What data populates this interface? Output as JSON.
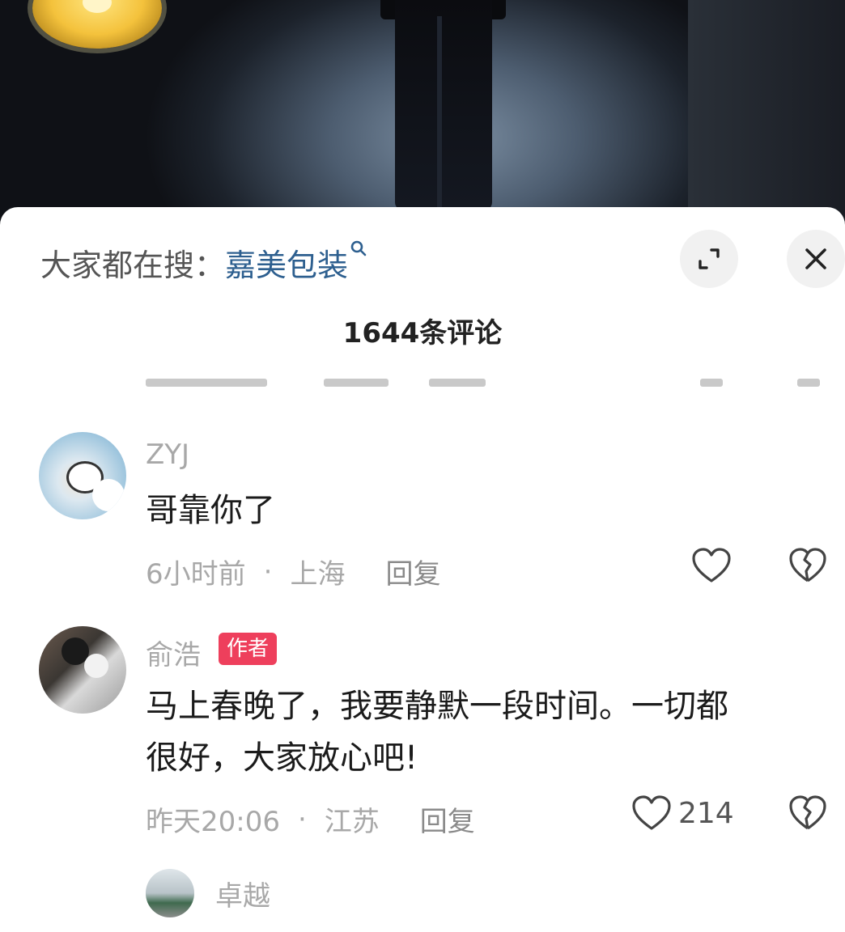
{
  "search_bar": {
    "prefix": "大家都在搜：",
    "term": "嘉美包装"
  },
  "comment_count": "1644条评论",
  "comments": [
    {
      "username": "ZYJ",
      "text": "哥靠你了",
      "time": "6小时前",
      "location": "上海",
      "reply_label": "回复",
      "likes": ""
    },
    {
      "username": "俞浩",
      "badge": "作者",
      "text_line1": "马上春晚了，我要静默一段时间。一切都",
      "text_line2": "很好，大家放心吧!",
      "time": "昨天20:06",
      "location": "江苏",
      "reply_label": "回复",
      "likes": "214"
    },
    {
      "username": "卓越"
    }
  ],
  "separator": "·",
  "colors": {
    "accent_link": "#2d5f8f",
    "author_badge": "#ee3f5c",
    "meta_gray": "#a8a8a8"
  },
  "icons": [
    "search-icon",
    "expand-icon",
    "close-icon",
    "heart-icon",
    "broken-heart-icon"
  ]
}
